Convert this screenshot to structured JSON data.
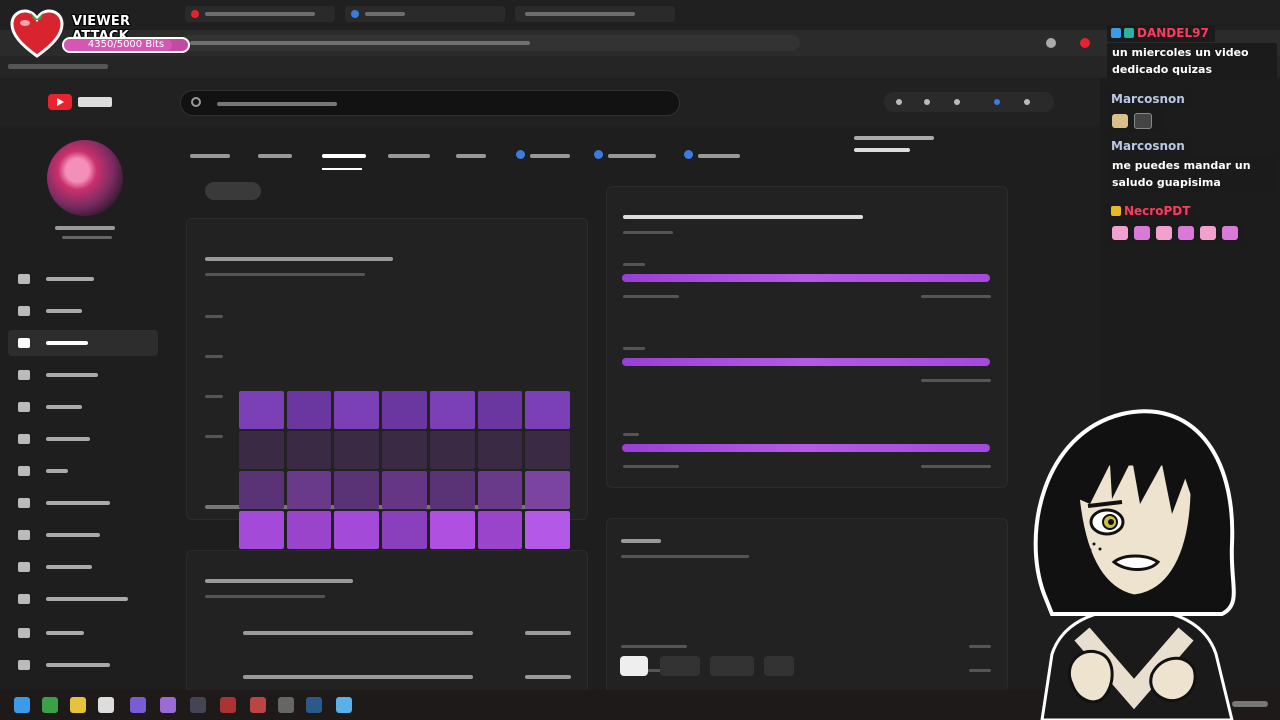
{
  "viewer_attack": {
    "title": "VIEWER ATTACK",
    "meter_text": "4350/5000 Bits",
    "progress": 0.87,
    "accent": "#c24aa0",
    "heart_color": "#d8242f"
  },
  "browser": {
    "tab_colors": [
      "#e8232d",
      "#3b7be0"
    ],
    "logo_icon": "video-platform-logo"
  },
  "app": {
    "accent": "#a349dc",
    "side_accent": "#e0508c"
  },
  "chat": {
    "messages": [
      {
        "user": "DANDEL97",
        "color": "#ff3b5c",
        "badges": [
          "prime-icon",
          "gift-icon"
        ],
        "text": "un miercoles un video dedicado quizas"
      },
      {
        "user": "Marcosnon",
        "color": "#b9c7e6",
        "badges": [],
        "emotes": [
          "cat-emote",
          "eyes-emote"
        ],
        "text": ""
      },
      {
        "user": "Marcosnon",
        "color": "#b9c7e6",
        "badges": [],
        "text": "me puedes mandar un saludo guapisima"
      },
      {
        "user": "NecroPDT",
        "color": "#ff3b5c",
        "badges": [
          "sub-badge"
        ],
        "emotes": [
          "pig-emote",
          "pig-emote",
          "pig-emote",
          "pig-emote",
          "pig-emote",
          "pig-emote"
        ],
        "text": ""
      }
    ]
  }
}
